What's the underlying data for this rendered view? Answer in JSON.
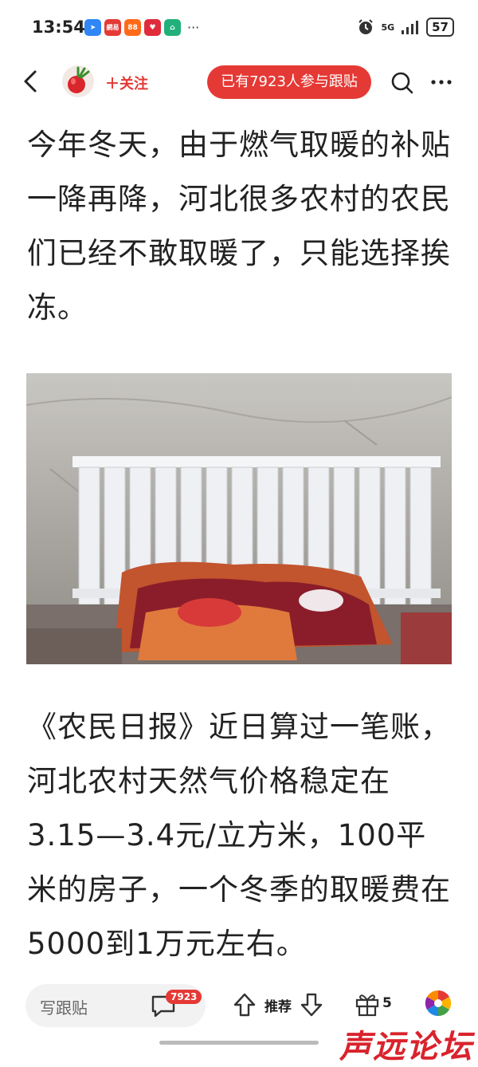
{
  "status_bar": {
    "time": "13:54",
    "app_icons": [
      {
        "name": "app-icon-blue",
        "color": "#2f86f6",
        "glyph": "➤"
      },
      {
        "name": "app-icon-netease",
        "color": "#e53935",
        "glyph": "網易"
      },
      {
        "name": "app-icon-orange",
        "color": "#ff6a1a",
        "glyph": "88"
      },
      {
        "name": "app-icon-red",
        "color": "#e02b3a",
        "glyph": "♥"
      },
      {
        "name": "app-icon-green",
        "color": "#21b07a",
        "glyph": "⌂"
      }
    ],
    "more": "···",
    "network": "5G",
    "battery": "57"
  },
  "nav": {
    "follow_label": "＋关注",
    "participants_badge": "已有7923人参与跟贴"
  },
  "article": {
    "paragraph_1": "今年冬天，由于燃气取暖的补贴一降再降，河北很多农村的农民们已经不敢取暖了，只能选择挨冻。",
    "paragraph_2": "《农民日报》近日算过一笔账，河北农村天然气价格稳定在3.15—3.4元/立方米，100平米的房子，一个冬季的取暖费在5000到1万元左右。"
  },
  "bottom_bar": {
    "reply_placeholder": "写跟贴",
    "comment_count": "7923",
    "recommend_label": "推荐",
    "gift_count": "5"
  },
  "watermark": "声远论坛",
  "colors": {
    "accent": "#e53935"
  }
}
